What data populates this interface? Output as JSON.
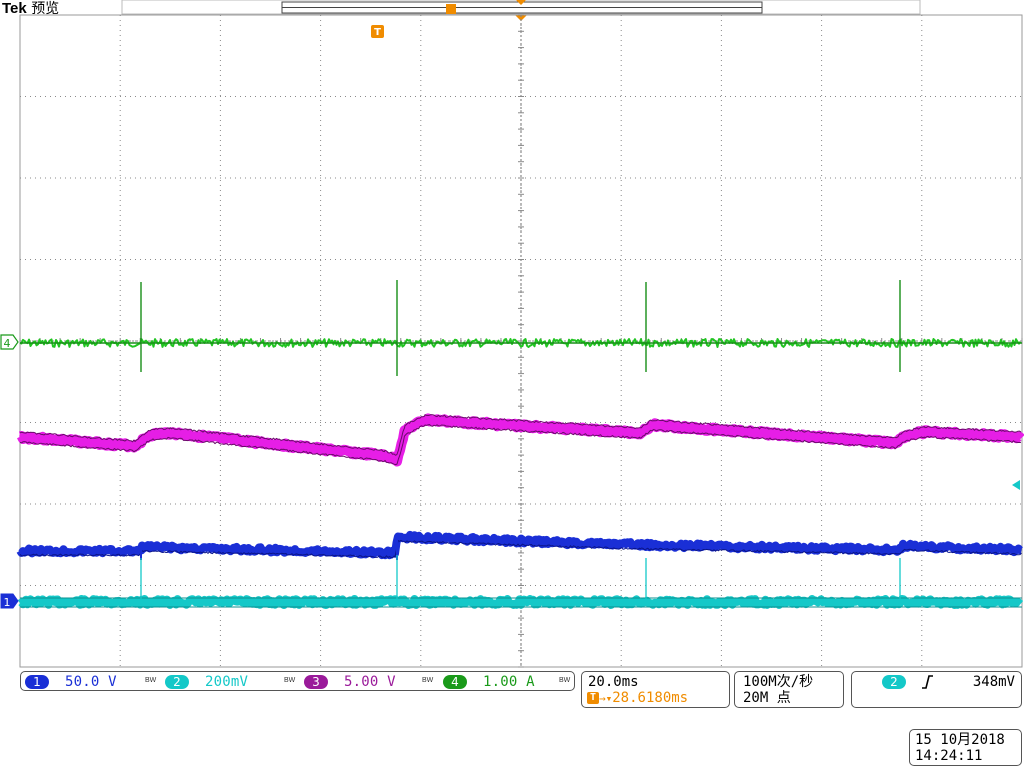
{
  "header": {
    "brand": "Tek",
    "mode": "预览"
  },
  "markers": {
    "trigger_marker": "T",
    "ch4_marker": "4",
    "ch1_marker": "1"
  },
  "channels": [
    {
      "num": "1",
      "value": "50.0 V",
      "color": "#1a2fd6"
    },
    {
      "num": "2",
      "value": "200mV",
      "color": "#14c8c8"
    },
    {
      "num": "3",
      "value": "5.00 V",
      "color": "#9a1a9a"
    },
    {
      "num": "4",
      "value": "1.00 A",
      "color": "#1a9a1a"
    }
  ],
  "bandwidth_label": "BW",
  "timebase": {
    "scale": "20.0ms",
    "trigger_position": "28.6180ms",
    "trigger_marker": "T"
  },
  "acquisition": {
    "sample_rate": "100M次/秒",
    "record_length": "20M 点"
  },
  "trigger": {
    "source": "2",
    "slope_icon": "rising-edge-icon",
    "level": "348mV"
  },
  "datetime": {
    "date": "15 10月2018",
    "time": "14:24:11"
  },
  "colors": {
    "ch1_blue": "#1a2fd6",
    "ch2_cyan": "#14c8c8",
    "ch3_magenta": "#e61ee6",
    "ch4_green": "#22c422",
    "marker_orange": "#f08c00"
  }
}
